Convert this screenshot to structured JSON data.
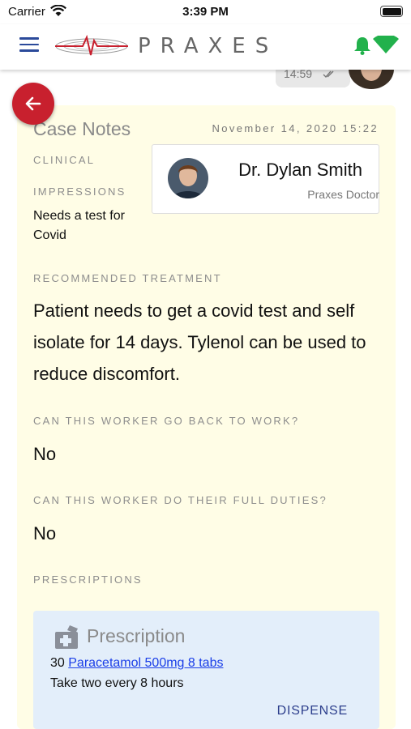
{
  "status_bar": {
    "carrier": "Carrier",
    "time": "3:39 PM"
  },
  "header": {
    "logo_text": "PRAXES",
    "brand_color": "#c8202e",
    "accent_color": "#2b4a9a",
    "status_color": "#22b14c"
  },
  "chat": {
    "message_time": "14:59"
  },
  "case_notes": {
    "title": "Case Notes",
    "date": "November 14, 2020 15:22",
    "clinical_label": "CLINICAL",
    "impressions_label": "IMPRESSIONS",
    "impressions_value": "Needs a test for Covid",
    "doctor": {
      "name": "Dr. Dylan Smith",
      "role": "Praxes Doctor"
    },
    "treatment_label": "RECOMMENDED TREATMENT",
    "treatment_value": "Patient needs to get a covid test and self isolate for 14 days. Tylenol can be used to reduce discomfort.",
    "back_to_work_label": "CAN THIS WORKER GO BACK TO WORK?",
    "back_to_work_value": "No",
    "full_duties_label": "CAN THIS WORKER DO THEIR FULL DUTIES?",
    "full_duties_value": "No",
    "prescriptions_label": "PRESCRIPTIONS",
    "prescription": {
      "title": "Prescription",
      "quantity": "30",
      "drug": "Paracetamol 500mg 8 tabs",
      "instructions": "Take two every 8 hours",
      "action": "DISPENSE"
    }
  },
  "icons": [
    "menu-icon",
    "wifi-icon",
    "battery-icon",
    "bell-icon",
    "signal-icon",
    "back-arrow-icon",
    "prescription-icon"
  ]
}
